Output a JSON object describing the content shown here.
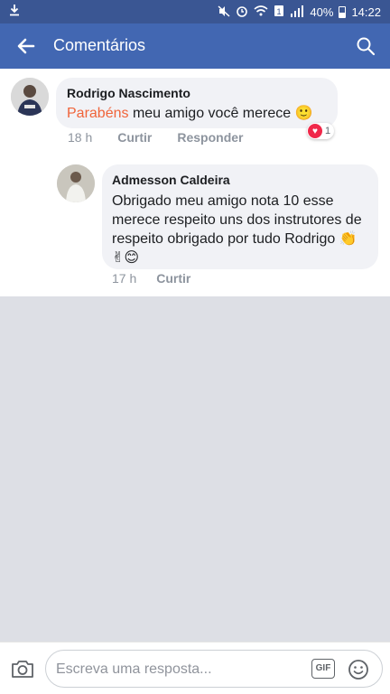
{
  "status_bar": {
    "battery": "40%",
    "time": "14:22"
  },
  "header": {
    "title": "Comentários"
  },
  "comments": [
    {
      "author": "Rodrigo Nascimento",
      "mention": "Parabéns",
      "text": " meu amigo você merece",
      "emoji": "🙂",
      "time": "18 h",
      "like_label": "Curtir",
      "reply_label": "Responder",
      "reaction_count": "1"
    },
    {
      "author": "Admesson Caldeira",
      "text": "Obrigado meu amigo nota 10 esse merece respeito uns dos instrutores de respeito  obrigado por tudo Rodrigo 👏✌😊",
      "time": "17 h",
      "like_label": "Curtir"
    }
  ],
  "composer": {
    "placeholder": "Escreva uma resposta...",
    "gif_label": "GIF"
  }
}
